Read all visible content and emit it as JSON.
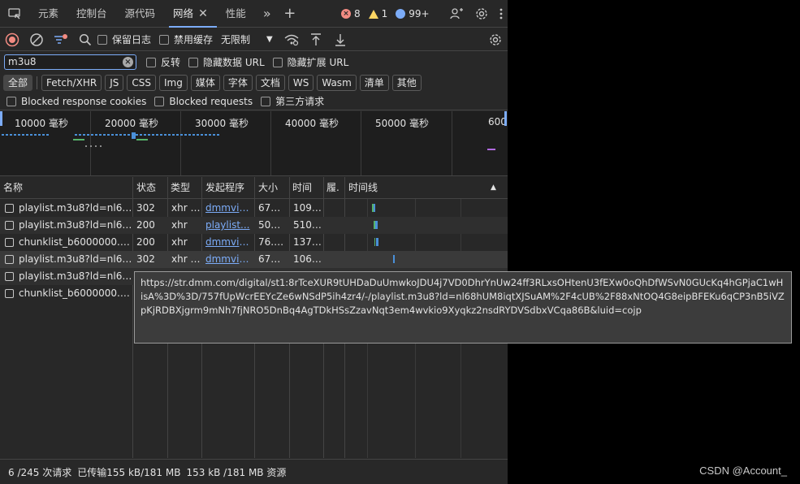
{
  "tabs": {
    "elements": "元素",
    "console": "控制台",
    "sources": "源代码",
    "network": "网络",
    "performance": "性能"
  },
  "counters": {
    "errors": "8",
    "warnings": "1",
    "info": "99+"
  },
  "toolbar": {
    "preserve_log": "保留日志",
    "disable_cache": "禁用缓存",
    "throttle": "无限制"
  },
  "filter": {
    "value": "m3u8",
    "invert": "反转",
    "hide_data_url": "隐藏数据 URL",
    "hide_ext_url": "隐藏扩展 URL"
  },
  "chips": [
    "全部",
    "Fetch/XHR",
    "JS",
    "CSS",
    "Img",
    "媒体",
    "字体",
    "文档",
    "WS",
    "Wasm",
    "清单",
    "其他"
  ],
  "block": {
    "cookies": "Blocked response cookies",
    "requests": "Blocked requests",
    "third_party": "第三方请求"
  },
  "overview_ticks": [
    "10000 毫秒",
    "20000 毫秒",
    "30000 毫秒",
    "40000 毫秒",
    "50000 毫秒",
    "600"
  ],
  "columns": {
    "name": "名称",
    "status": "状态",
    "type": "类型",
    "initiator": "发起程序",
    "size": "大小",
    "time": "时间",
    "priority": "履.",
    "waterfall": "时间线"
  },
  "rows": [
    {
      "name": "playlist.m3u8?ld=nl68h...",
      "status": "302",
      "type": "xhr /...",
      "initiator": "dmmvid...",
      "size": "673 B",
      "time": "109 ..."
    },
    {
      "name": "playlist.m3u8?ld=nl68h...",
      "status": "200",
      "type": "xhr",
      "initiator": "playlist...",
      "size": "502 B",
      "time": "510 ..."
    },
    {
      "name": "chunklist_b6000000.m3...",
      "status": "200",
      "type": "xhr",
      "initiator": "dmmvid...",
      "size": "76.5...",
      "time": "137 ..."
    },
    {
      "name": "playlist.m3u8?ld=nl68h...",
      "status": "302",
      "type": "xhr /...",
      "initiator": "dmmvid...",
      "size": "673 B",
      "time": "106 ..."
    },
    {
      "name": "playlist.m3u8?ld=nl68h...",
      "status": "",
      "type": "",
      "initiator": "",
      "size": "",
      "time": ""
    },
    {
      "name": "chunklist_b6000000.m3...",
      "status": "",
      "type": "",
      "initiator": "",
      "size": "",
      "time": ""
    }
  ],
  "tooltip": "https://str.dmm.com/digital/st1:8rTceXUR9tUHDaDuUmwkoJDU4j7VD0DhrYnUw24ff3RLxsOHtenU3fEXw0oQhDfWSvN0GUcKq4hGPjaC1wHisA%3D%3D/757fUpWcrEEYcZe6wNSdP5ih4zr4/-/playlist.m3u8?ld=nl68hUM8iqtXJSuAM%2F4cUB%2F88xNtOQ4G8eipBFEKu6qCP3nB5iVZpKjRDBXjgrm9mNh7fjNRO5DnBq4AgTDkHSsZzavNqt3em4wvkio9Xyqkz2nsdRYDVSdbxVCqa86B&luid=cojp",
  "status": {
    "requests": "6 /245 次请求",
    "transferred": "已传输155 kB/181 MB",
    "resources": "153 kB /181 MB 资源"
  },
  "watermark": "CSDN @Account_",
  "colors": {
    "accent": "#7cacf8",
    "error": "#f28b82",
    "warning": "#fdd663",
    "panel": "#282828"
  }
}
